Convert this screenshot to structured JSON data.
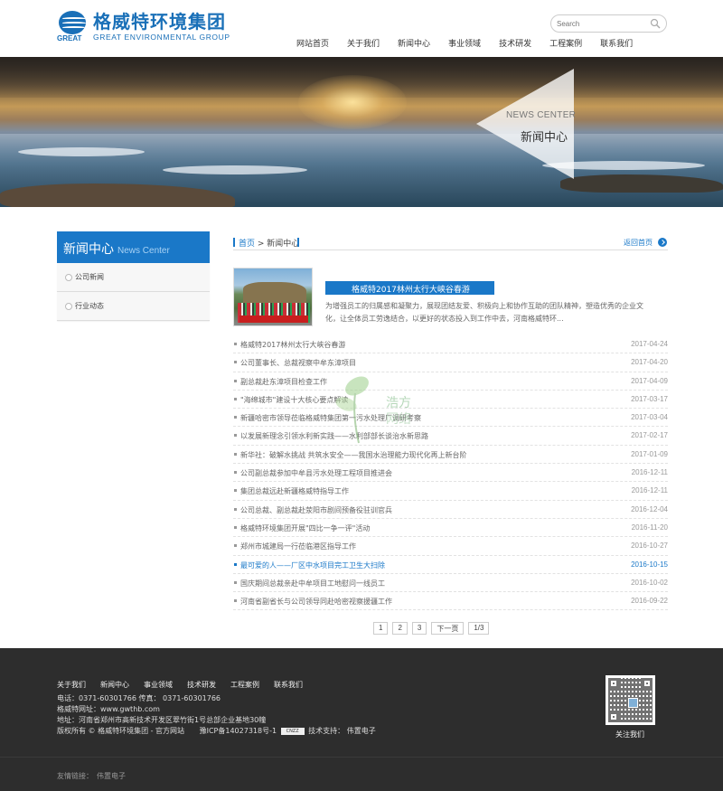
{
  "brand": {
    "cn": "格威特环境集团",
    "en": "GREAT ENVIRONMENTAL GROUP",
    "mark_text": "GREAT",
    "color": "#1a70b8"
  },
  "search": {
    "placeholder": "Search"
  },
  "nav": [
    "网站首页",
    "关于我们",
    "新闻中心",
    "事业领域",
    "技术研发",
    "工程案例",
    "联系我们"
  ],
  "banner": {
    "en": "NEWS CENTER",
    "cn": "新闻中心"
  },
  "sidebar": {
    "title_cn": "新闻中心",
    "title_en": "News Center",
    "items": [
      {
        "label": "公司新闻"
      },
      {
        "label": "行业动态"
      }
    ],
    "accent": "#1a78c8"
  },
  "breadcrumb": {
    "home": "首页",
    "sep": " > ",
    "current": "新闻中心",
    "back": "返回首页"
  },
  "featured": {
    "title": "格威特2017林州太行大峡谷春游",
    "desc": "为增强员工的归属感和凝聚力，展现团结友爱、积极向上和协作互助的团队精神，塑造优秀的企业文化，让全体员工劳逸结合，以更好的状态投入到工作中去，河南格威特环..."
  },
  "news": [
    {
      "title": "格威特2017林州太行大峡谷春游",
      "date": "2017-04-24"
    },
    {
      "title": "公司董事长、总裁视察中牟东漳项目",
      "date": "2017-04-20"
    },
    {
      "title": "副总裁赴东漳项目检查工作",
      "date": "2017-04-09"
    },
    {
      "title": "\"海绵城市\"建设十大核心要点解读",
      "date": "2017-03-17"
    },
    {
      "title": "新疆哈密市领导莅临格威特集团第一污水处理厂调研考察",
      "date": "2017-03-04"
    },
    {
      "title": "以发展新理念引领水利新实践——水利部部长谈治水新思路",
      "date": "2017-02-17"
    },
    {
      "title": "新华社：破解水挑战 共筑水安全——我国水治理能力现代化再上新台阶",
      "date": "2017-01-09"
    },
    {
      "title": "公司副总裁参加中牟县污水处理工程项目推进会",
      "date": "2016-12-11"
    },
    {
      "title": "集团总裁远赴新疆格威特指导工作",
      "date": "2016-12-11"
    },
    {
      "title": "公司总裁、副总裁赴荥阳市剧间预备役驻训官兵",
      "date": "2016-12-04"
    },
    {
      "title": "格威特环境集团开展\"四比一争一评\"活动",
      "date": "2016-11-20"
    },
    {
      "title": "郑州市城建局一行莅临港区指导工作",
      "date": "2016-10-27"
    },
    {
      "title": "最可爱的人——厂区中水项目完工卫生大扫除",
      "date": "2016-10-15",
      "active": true
    },
    {
      "title": "国庆期间总裁亲赴中牟项目工地慰问一线员工",
      "date": "2016-10-02"
    },
    {
      "title": "河南省副省长与公司领导同赴哈密视察援疆工作",
      "date": "2016-09-22"
    }
  ],
  "pager": [
    "1",
    "2",
    "3",
    "下一页",
    "1/3"
  ],
  "watermark": {
    "line1": "浩方",
    "line2": "网络"
  },
  "footer": {
    "links": [
      "关于我们",
      "新闻中心",
      "事业领域",
      "技术研发",
      "工程案例",
      "联系我们"
    ],
    "phone": "电话：0371-60301766 传真： 0371-60301766",
    "website": "格威特网址：www.gwthb.com",
    "address": "地址：河南省郑州市高新技术开发区翠竹街1号总部企业基地30幢",
    "copyright": "版权所有 © 格威特环境集团 - 官方网站",
    "icp": "豫ICP备14027318号-1",
    "icp_badge": "CNZZ",
    "support": "技术支持： 伟置电子",
    "qr_label": "关注我们",
    "friend_label": "友情链接：",
    "friend_link": "伟置电子",
    "bg": "#2d2d2d"
  }
}
